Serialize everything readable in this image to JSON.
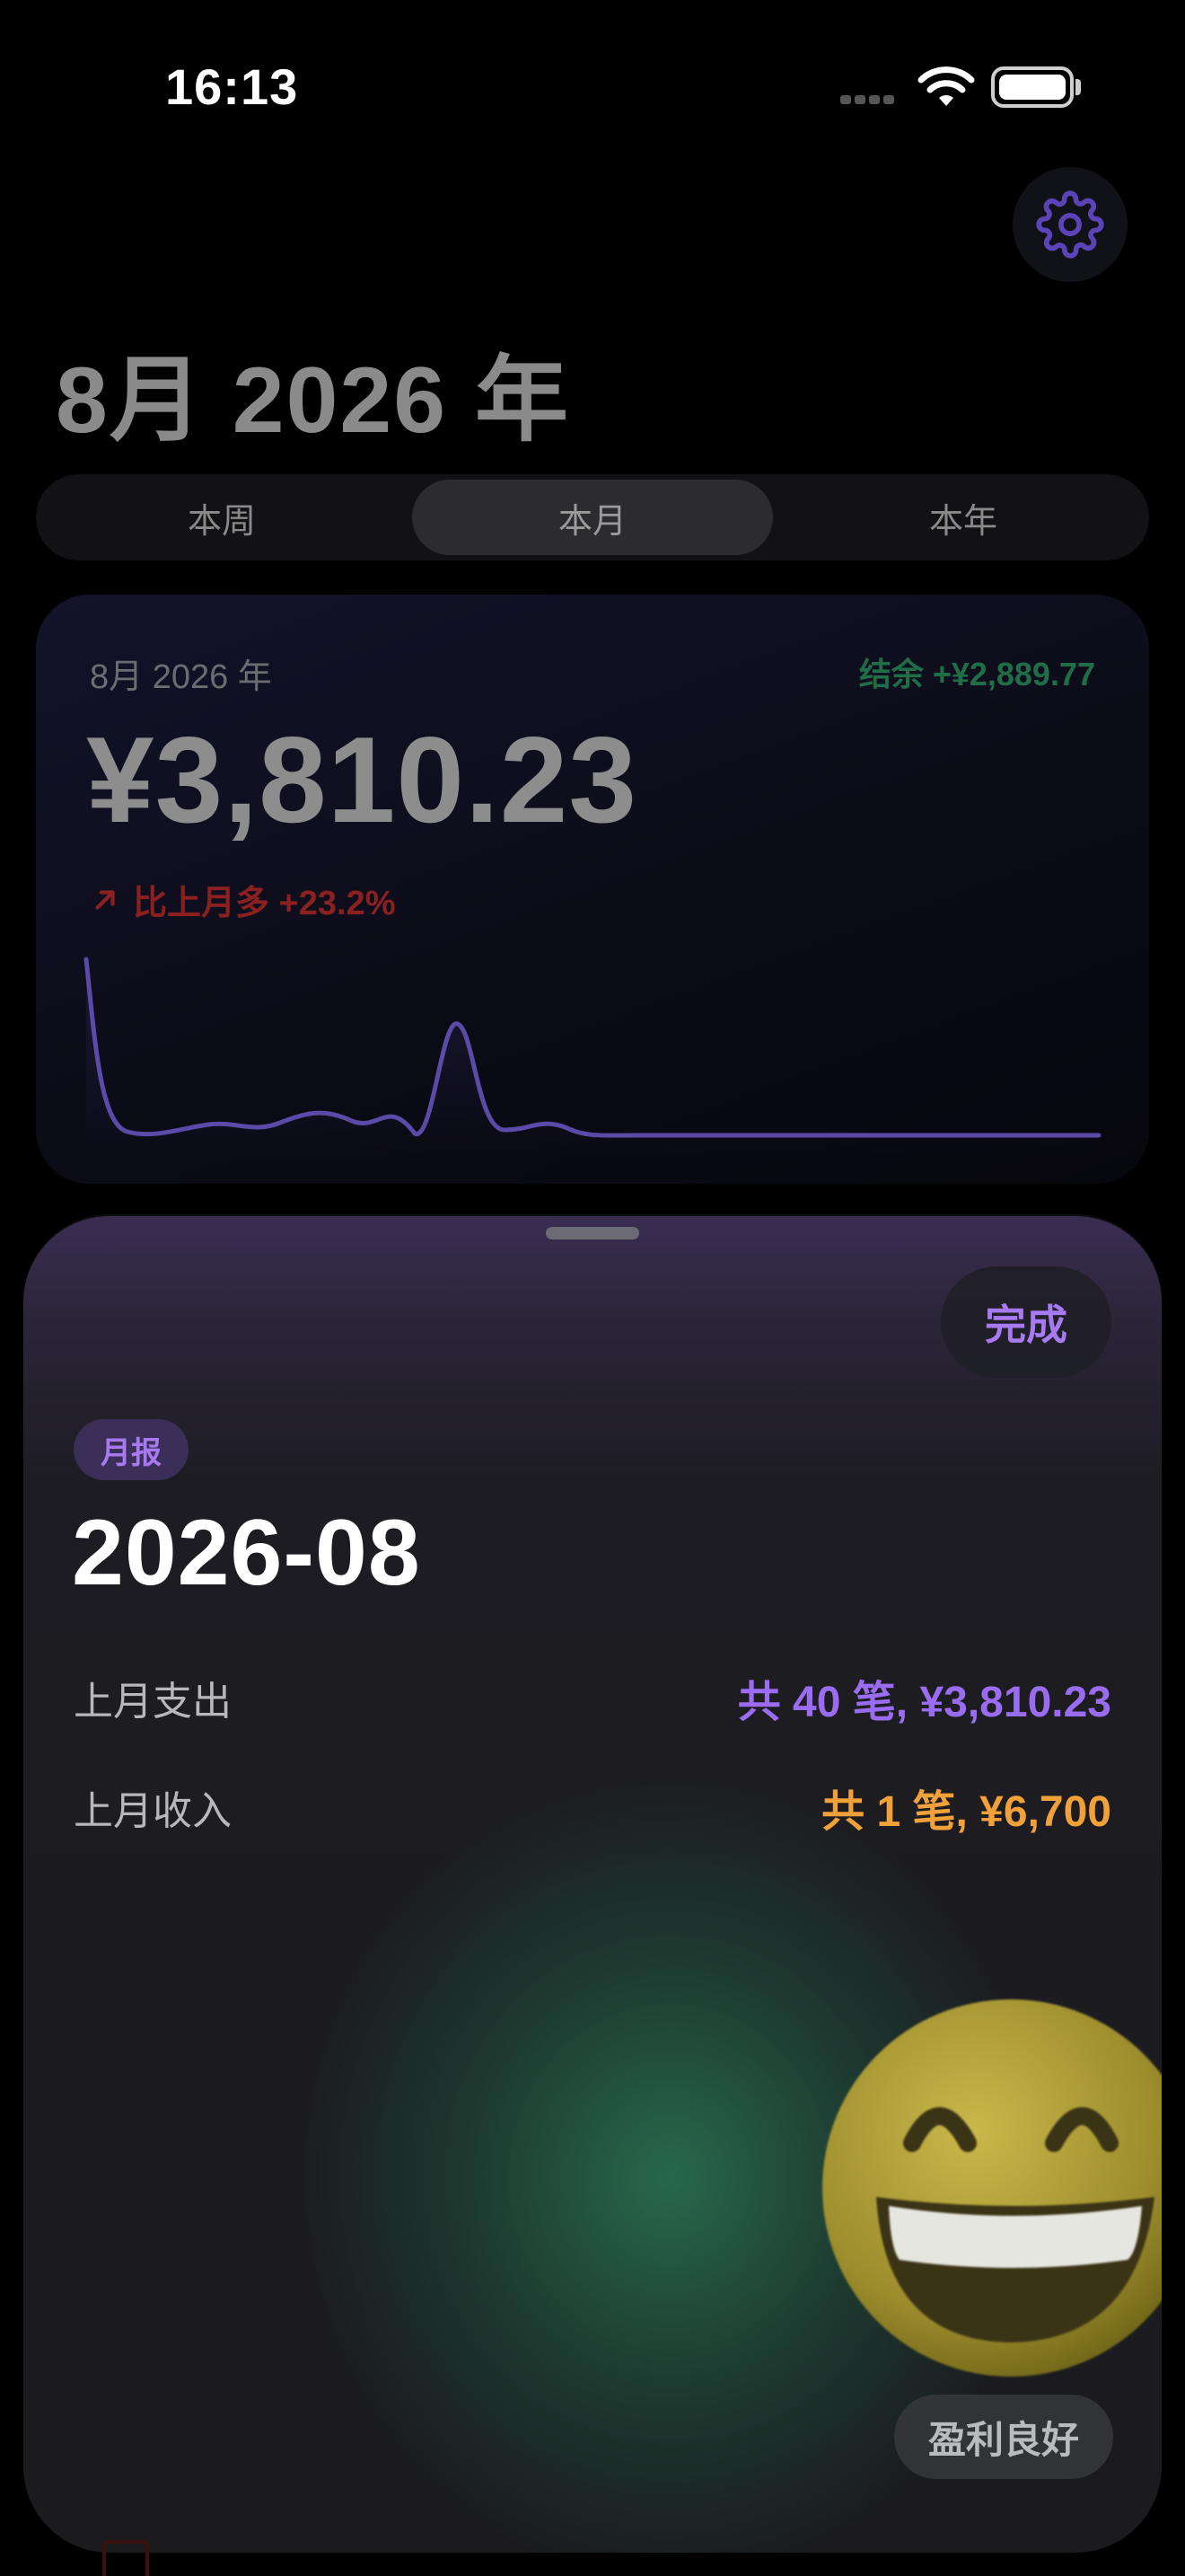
{
  "status_bar": {
    "time": "16:13",
    "icons": [
      "cellular-signal-icon",
      "wifi-icon",
      "battery-icon"
    ]
  },
  "header": {
    "title": "8月 2026 年",
    "settings_icon": "gear-icon"
  },
  "tabs": [
    {
      "label": "本周",
      "active": false
    },
    {
      "label": "本月",
      "active": true
    },
    {
      "label": "本年",
      "active": false
    }
  ],
  "summary": {
    "period": "8月 2026 年",
    "balance": "结余 +¥2,889.77",
    "amount": "¥3,810.23",
    "trend_icon": "arrow-up-right-icon",
    "trend": "比上月多 +23.2%",
    "colors": {
      "balance": "#1f6e48",
      "trend": "#8a2020",
      "line": "#5b4aa8"
    }
  },
  "sheet": {
    "done_label": "完成",
    "badge": "月报",
    "title": "2026-08",
    "rows": [
      {
        "label": "上月支出",
        "value": "共 40 笔, ¥3,810.23",
        "kind": "expense"
      },
      {
        "label": "上月收入",
        "value": "共 1 笔, ¥6,700",
        "kind": "income"
      }
    ],
    "mood_icon": "grinning-face-icon",
    "mood": "盈利良好",
    "colors": {
      "accent": "#a77af2",
      "expense": "#9a6cf2",
      "income": "#f1a13a"
    }
  }
}
